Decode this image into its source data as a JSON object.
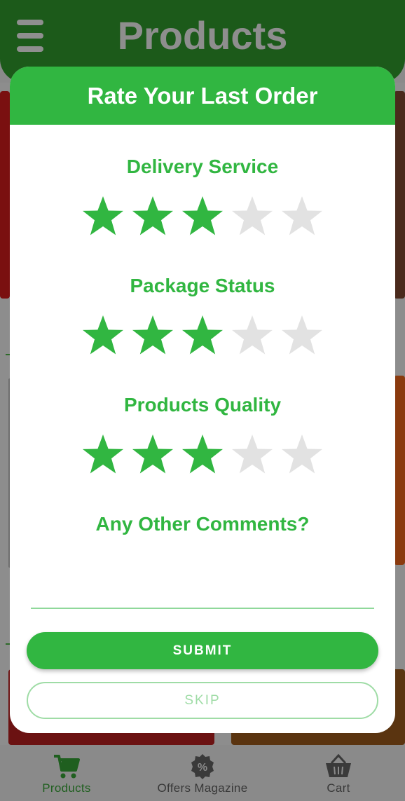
{
  "app": {
    "title": "Products"
  },
  "modal": {
    "title": "Rate Your Last Order",
    "ratings": [
      {
        "label": "Delivery Service",
        "value": 3,
        "max": 5
      },
      {
        "label": "Package Status",
        "value": 3,
        "max": 5
      },
      {
        "label": "Products Quality",
        "value": 3,
        "max": 5
      }
    ],
    "comments_label": "Any Other Comments?",
    "comment_value": "",
    "submit_label": "SUBMIT",
    "skip_label": "SKIP"
  },
  "bottom_nav": {
    "items": [
      {
        "label": "Products",
        "icon": "cart-icon",
        "active": true
      },
      {
        "label": "Offers Magazine",
        "icon": "percent-badge-icon",
        "active": false
      },
      {
        "label": "Cart",
        "icon": "basket-icon",
        "active": false
      }
    ]
  },
  "colors": {
    "accent": "#31b641",
    "header_dark": "#1c5a1a",
    "star_filled": "#31b641",
    "star_empty": "#e2e2e2"
  }
}
